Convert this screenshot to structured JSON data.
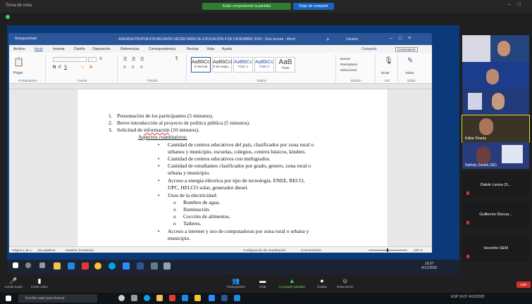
{
  "meeting": {
    "window_title": "Toma de vista",
    "share_text": "Estás compartiendo la pantalla",
    "stop_share": "Dejar de compartir"
  },
  "word": {
    "autosave": "Autoguardado",
    "title": "AGENDA PROPUESTA REUNIÓN SECRETARÍA DE EDUCACIÓN 4 DE DICIEMBRE 2020 - Solo lectura - Word",
    "user": "Usuario",
    "menu": [
      "Archivo",
      "Inicio",
      "Insertar",
      "Diseño",
      "Disposición",
      "Referencias",
      "Correspondencia",
      "Revisar",
      "Vista",
      "Ayuda"
    ],
    "share": "Compartir",
    "comments": "Comentarios",
    "ribbon_groups": [
      "Portapapeles",
      "Fuente",
      "Párrafo",
      "Estilos",
      "Edición",
      "Voz",
      "Editor"
    ],
    "paste": "Pegar",
    "font_name": "Times New Roman",
    "font_size": "12",
    "styles": [
      {
        "sample": "AaBbCcI",
        "name": "¶ Normal"
      },
      {
        "sample": "AaBbCcI",
        "name": "¶ Sin espa..."
      },
      {
        "sample": "AaBbCc",
        "name": "Título 1"
      },
      {
        "sample": "AaBbCc",
        "name": "Título 2"
      },
      {
        "sample": "AaB",
        "name": "Título"
      }
    ],
    "find": "Buscar",
    "replace": "Reemplazar",
    "select": "Seleccionar",
    "dictate": "Dictar",
    "editor": "Editor",
    "status_left": "Página 1 de 1",
    "status_words": "116 palabras",
    "status_lang": "Español (Honduras)",
    "status_focus": "Configuración de visualización",
    "status_focus2": "Concentración",
    "zoom": "100 %"
  },
  "document": {
    "items": [
      {
        "num": "1.",
        "text": "Presentación de los participantes (5 minutos)."
      },
      {
        "num": "2.",
        "text": "Breve introducción al proyecto de política pública (5 minutos)."
      },
      {
        "num": "3.",
        "text_pre": "Solicitud de ",
        "text_u": "información",
        "text_post": " (10 minutos)."
      }
    ],
    "heading": "Aspectos cuantitativos:",
    "bullets": [
      [
        "Cantidad de centros educativos del país, clasificados por zona rural o",
        "urbanos y municipio, escuelas, colegios, centros básicos, kínders."
      ],
      [
        "Cantidad de centros educativos con multigrados."
      ],
      [
        "Cantidad de estudiantes clasificados por grado, genero, zona rural o",
        "urbana y municipio."
      ],
      [
        "Acceso a energía eléctrica por tipo de tecnología. ENEE, RECO,",
        "UPC, HELCO solar, generador diesel."
      ],
      [
        "Usos de la electricidad:"
      ]
    ],
    "sub_bullets": [
      "Bombeo de agua.",
      "Iluminación.",
      "Cocción de alimentos.",
      "Talleres."
    ],
    "last_bullet": [
      "Acceso a internet y uso de computadoras por zona rural o urbana y",
      "municipio."
    ]
  },
  "inner_taskbar": {
    "time": "16:07",
    "date": "4/12/2020"
  },
  "participants": [
    {
      "name": "",
      "video": true
    },
    {
      "name": "",
      "video": true
    },
    {
      "name": "",
      "video": true
    },
    {
      "name": "Editar Pineda",
      "video": true,
      "active": true
    },
    {
      "name": "Nathaly Zavala (SE)",
      "video": true
    },
    {
      "name": "Dalvin Lanza (S...",
      "video": false
    },
    {
      "name": "Guillermo Discua...",
      "video": false
    },
    {
      "name": "Vecoriho SEM",
      "video": false
    }
  ],
  "controls": [
    {
      "icon": "mic-icon",
      "label": "Activar audio"
    },
    {
      "icon": "video-icon",
      "label": "Iniciar video"
    },
    {
      "icon": "participants-icon",
      "label": "Participantes"
    },
    {
      "icon": "chat-icon",
      "label": "Chat"
    },
    {
      "icon": "share-screen-icon",
      "label": "Compartir pantalla"
    },
    {
      "icon": "record-icon",
      "label": "Grabar"
    },
    {
      "icon": "reactions-icon",
      "label": "Reacciones"
    }
  ],
  "leave_label": "Salir",
  "os": {
    "search_placeholder": "Escribe aquí para buscar",
    "tray": "ESP  16:07  4/12/2020"
  },
  "colors": {
    "word_blue": "#2b579a",
    "share_green": "#2e7d32",
    "leave_red": "#d32f2f"
  }
}
